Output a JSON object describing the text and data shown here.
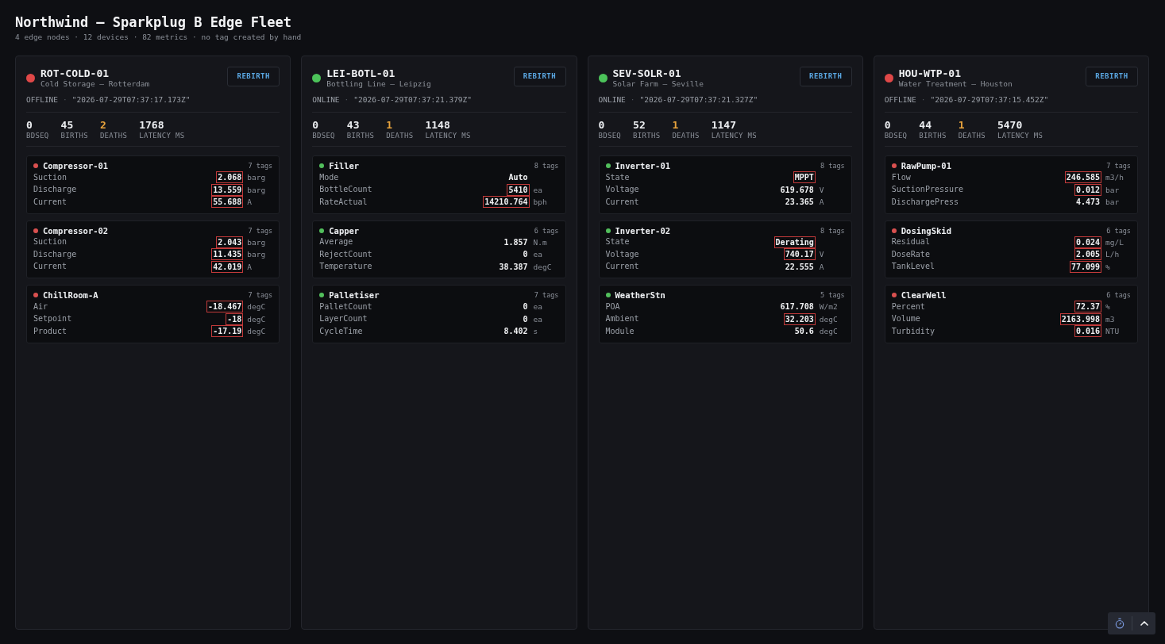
{
  "page": {
    "title": "Northwind — Sparkplug B Edge Fleet",
    "subtitle": "4 edge nodes · 12 devices · 82 metrics · no tag created by hand"
  },
  "nodes": [
    {
      "name": "ROT-COLD-01",
      "location": "Cold Storage — Rotterdam",
      "online": false,
      "status": "OFFLINE",
      "separator": "·",
      "timestamp": "\"2026-07-29T07:37:17.173Z\"",
      "rebirth_label": "REBIRTH",
      "stats": [
        {
          "value": "0",
          "label": "BDSEQ",
          "warn": false
        },
        {
          "value": "45",
          "label": "BIRTHS",
          "warn": false
        },
        {
          "value": "2",
          "label": "DEATHS",
          "warn": true
        },
        {
          "value": "1768",
          "label": "LATENCY MS",
          "warn": false
        }
      ],
      "devices": [
        {
          "name": "Compressor-01",
          "online": false,
          "tag_count": "7 tags",
          "metrics": [
            {
              "name": "Suction",
              "value": "2.068",
              "unit": "barg",
              "flagged": true
            },
            {
              "name": "Discharge",
              "value": "13.559",
              "unit": "barg",
              "flagged": true
            },
            {
              "name": "Current",
              "value": "55.688",
              "unit": "A",
              "flagged": true
            }
          ]
        },
        {
          "name": "Compressor-02",
          "online": false,
          "tag_count": "7 tags",
          "metrics": [
            {
              "name": "Suction",
              "value": "2.043",
              "unit": "barg",
              "flagged": true
            },
            {
              "name": "Discharge",
              "value": "11.435",
              "unit": "barg",
              "flagged": true
            },
            {
              "name": "Current",
              "value": "42.019",
              "unit": "A",
              "flagged": true
            }
          ]
        },
        {
          "name": "ChillRoom-A",
          "online": false,
          "tag_count": "7 tags",
          "metrics": [
            {
              "name": "Air",
              "value": "-18.467",
              "unit": "degC",
              "flagged": true
            },
            {
              "name": "Setpoint",
              "value": "-18",
              "unit": "degC",
              "flagged": true
            },
            {
              "name": "Product",
              "value": "-17.19",
              "unit": "degC",
              "flagged": true
            }
          ]
        }
      ]
    },
    {
      "name": "LEI-BOTL-01",
      "location": "Bottling Line — Leipzig",
      "online": true,
      "status": "ONLINE",
      "separator": "·",
      "timestamp": "\"2026-07-29T07:37:21.379Z\"",
      "rebirth_label": "REBIRTH",
      "stats": [
        {
          "value": "0",
          "label": "BDSEQ",
          "warn": false
        },
        {
          "value": "43",
          "label": "BIRTHS",
          "warn": false
        },
        {
          "value": "1",
          "label": "DEATHS",
          "warn": true
        },
        {
          "value": "1148",
          "label": "LATENCY MS",
          "warn": false
        }
      ],
      "devices": [
        {
          "name": "Filler",
          "online": true,
          "tag_count": "8 tags",
          "metrics": [
            {
              "name": "Mode",
              "value": "Auto",
              "flagged": false
            },
            {
              "name": "BottleCount",
              "value": "5410",
              "unit": "ea",
              "flagged": true
            },
            {
              "name": "RateActual",
              "value": "14210.764",
              "unit": "bph",
              "flagged": true
            }
          ]
        },
        {
          "name": "Capper",
          "online": true,
          "tag_count": "6 tags",
          "metrics": [
            {
              "name": "Average",
              "value": "1.857",
              "unit": "N.m",
              "flagged": false
            },
            {
              "name": "RejectCount",
              "value": "0",
              "unit": "ea",
              "flagged": false
            },
            {
              "name": "Temperature",
              "value": "38.387",
              "unit": "degC",
              "flagged": false
            }
          ]
        },
        {
          "name": "Palletiser",
          "online": true,
          "tag_count": "7 tags",
          "metrics": [
            {
              "name": "PalletCount",
              "value": "0",
              "unit": "ea",
              "flagged": false
            },
            {
              "name": "LayerCount",
              "value": "0",
              "unit": "ea",
              "flagged": false
            },
            {
              "name": "CycleTime",
              "value": "8.402",
              "unit": "s",
              "flagged": false
            }
          ]
        }
      ]
    },
    {
      "name": "SEV-SOLR-01",
      "location": "Solar Farm — Seville",
      "online": true,
      "status": "ONLINE",
      "separator": "·",
      "timestamp": "\"2026-07-29T07:37:21.327Z\"",
      "rebirth_label": "REBIRTH",
      "stats": [
        {
          "value": "0",
          "label": "BDSEQ",
          "warn": false
        },
        {
          "value": "52",
          "label": "BIRTHS",
          "warn": false
        },
        {
          "value": "1",
          "label": "DEATHS",
          "warn": true
        },
        {
          "value": "1147",
          "label": "LATENCY MS",
          "warn": false
        }
      ],
      "devices": [
        {
          "name": "Inverter-01",
          "online": true,
          "tag_count": "8 tags",
          "metrics": [
            {
              "name": "State",
              "value": "MPPT",
              "flagged": true
            },
            {
              "name": "Voltage",
              "value": "619.678",
              "unit": "V",
              "flagged": false
            },
            {
              "name": "Current",
              "value": "23.365",
              "unit": "A",
              "flagged": false
            }
          ]
        },
        {
          "name": "Inverter-02",
          "online": true,
          "tag_count": "8 tags",
          "metrics": [
            {
              "name": "State",
              "value": "Derating",
              "flagged": true
            },
            {
              "name": "Voltage",
              "value": "740.17",
              "unit": "V",
              "flagged": true
            },
            {
              "name": "Current",
              "value": "22.555",
              "unit": "A",
              "flagged": false
            }
          ]
        },
        {
          "name": "WeatherStn",
          "online": true,
          "tag_count": "5 tags",
          "metrics": [
            {
              "name": "POA",
              "value": "617.708",
              "unit": "W/m2",
              "flagged": false
            },
            {
              "name": "Ambient",
              "value": "32.203",
              "unit": "degC",
              "flagged": true
            },
            {
              "name": "Module",
              "value": "50.6",
              "unit": "degC",
              "flagged": false
            }
          ]
        }
      ]
    },
    {
      "name": "HOU-WTP-01",
      "location": "Water Treatment — Houston",
      "online": false,
      "status": "OFFLINE",
      "separator": "·",
      "timestamp": "\"2026-07-29T07:37:15.452Z\"",
      "rebirth_label": "REBIRTH",
      "stats": [
        {
          "value": "0",
          "label": "BDSEQ",
          "warn": false
        },
        {
          "value": "44",
          "label": "BIRTHS",
          "warn": false
        },
        {
          "value": "1",
          "label": "DEATHS",
          "warn": true
        },
        {
          "value": "5470",
          "label": "LATENCY MS",
          "warn": false
        }
      ],
      "devices": [
        {
          "name": "RawPump-01",
          "online": false,
          "tag_count": "7 tags",
          "metrics": [
            {
              "name": "Flow",
              "value": "246.585",
              "unit": "m3/h",
              "flagged": true
            },
            {
              "name": "SuctionPressure",
              "value": "0.012",
              "unit": "bar",
              "flagged": true
            },
            {
              "name": "DischargePress",
              "value": "4.473",
              "unit": "bar",
              "flagged": false
            }
          ]
        },
        {
          "name": "DosingSkid",
          "online": false,
          "tag_count": "6 tags",
          "metrics": [
            {
              "name": "Residual",
              "value": "0.024",
              "unit": "mg/L",
              "flagged": true
            },
            {
              "name": "DoseRate",
              "value": "2.005",
              "unit": "L/h",
              "flagged": true
            },
            {
              "name": "TankLevel",
              "value": "77.099",
              "unit": "%",
              "flagged": true
            }
          ]
        },
        {
          "name": "ClearWell",
          "online": false,
          "tag_count": "6 tags",
          "metrics": [
            {
              "name": "Percent",
              "value": "72.37",
              "unit": "%",
              "flagged": true
            },
            {
              "name": "Volume",
              "value": "2163.998",
              "unit": "m3",
              "flagged": true
            },
            {
              "name": "Turbidity",
              "value": "0.016",
              "unit": "NTU",
              "flagged": true
            }
          ]
        }
      ]
    }
  ]
}
